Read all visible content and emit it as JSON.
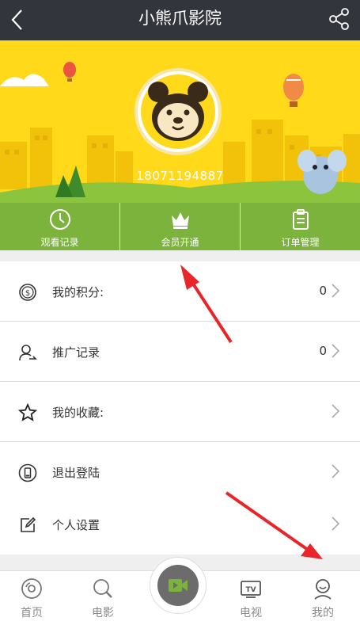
{
  "header": {
    "title": "小熊爪影院",
    "back_icon": "back-arrow-icon",
    "share_icon": "share-icon"
  },
  "profile": {
    "phone": "18071194887"
  },
  "quick_actions": [
    {
      "label": "观看记录",
      "icon": "clock-icon"
    },
    {
      "label": "会员开通",
      "icon": "crown-icon"
    },
    {
      "label": "订单管理",
      "icon": "clipboard-icon"
    }
  ],
  "menu": {
    "points": {
      "label": "我的积分:",
      "value": "0",
      "icon": "dollar-coin-icon"
    },
    "promotion": {
      "label": "推广记录",
      "value": "0",
      "icon": "user-share-icon"
    },
    "favorites": {
      "label": "我的收藏:",
      "icon": "star-icon"
    },
    "logout": {
      "label": "退出登陆",
      "icon": "phone-icon"
    },
    "settings": {
      "label": "个人设置",
      "icon": "edit-icon"
    }
  },
  "tabbar": {
    "home": "首页",
    "movie": "电影",
    "tv": "电视",
    "mine": "我的"
  },
  "colors": {
    "header_bg": "#32353b",
    "banner_bg": "#ffd91a",
    "quickbar_bg": "#7cb33c",
    "annotation_arrow": "#e8262a"
  }
}
